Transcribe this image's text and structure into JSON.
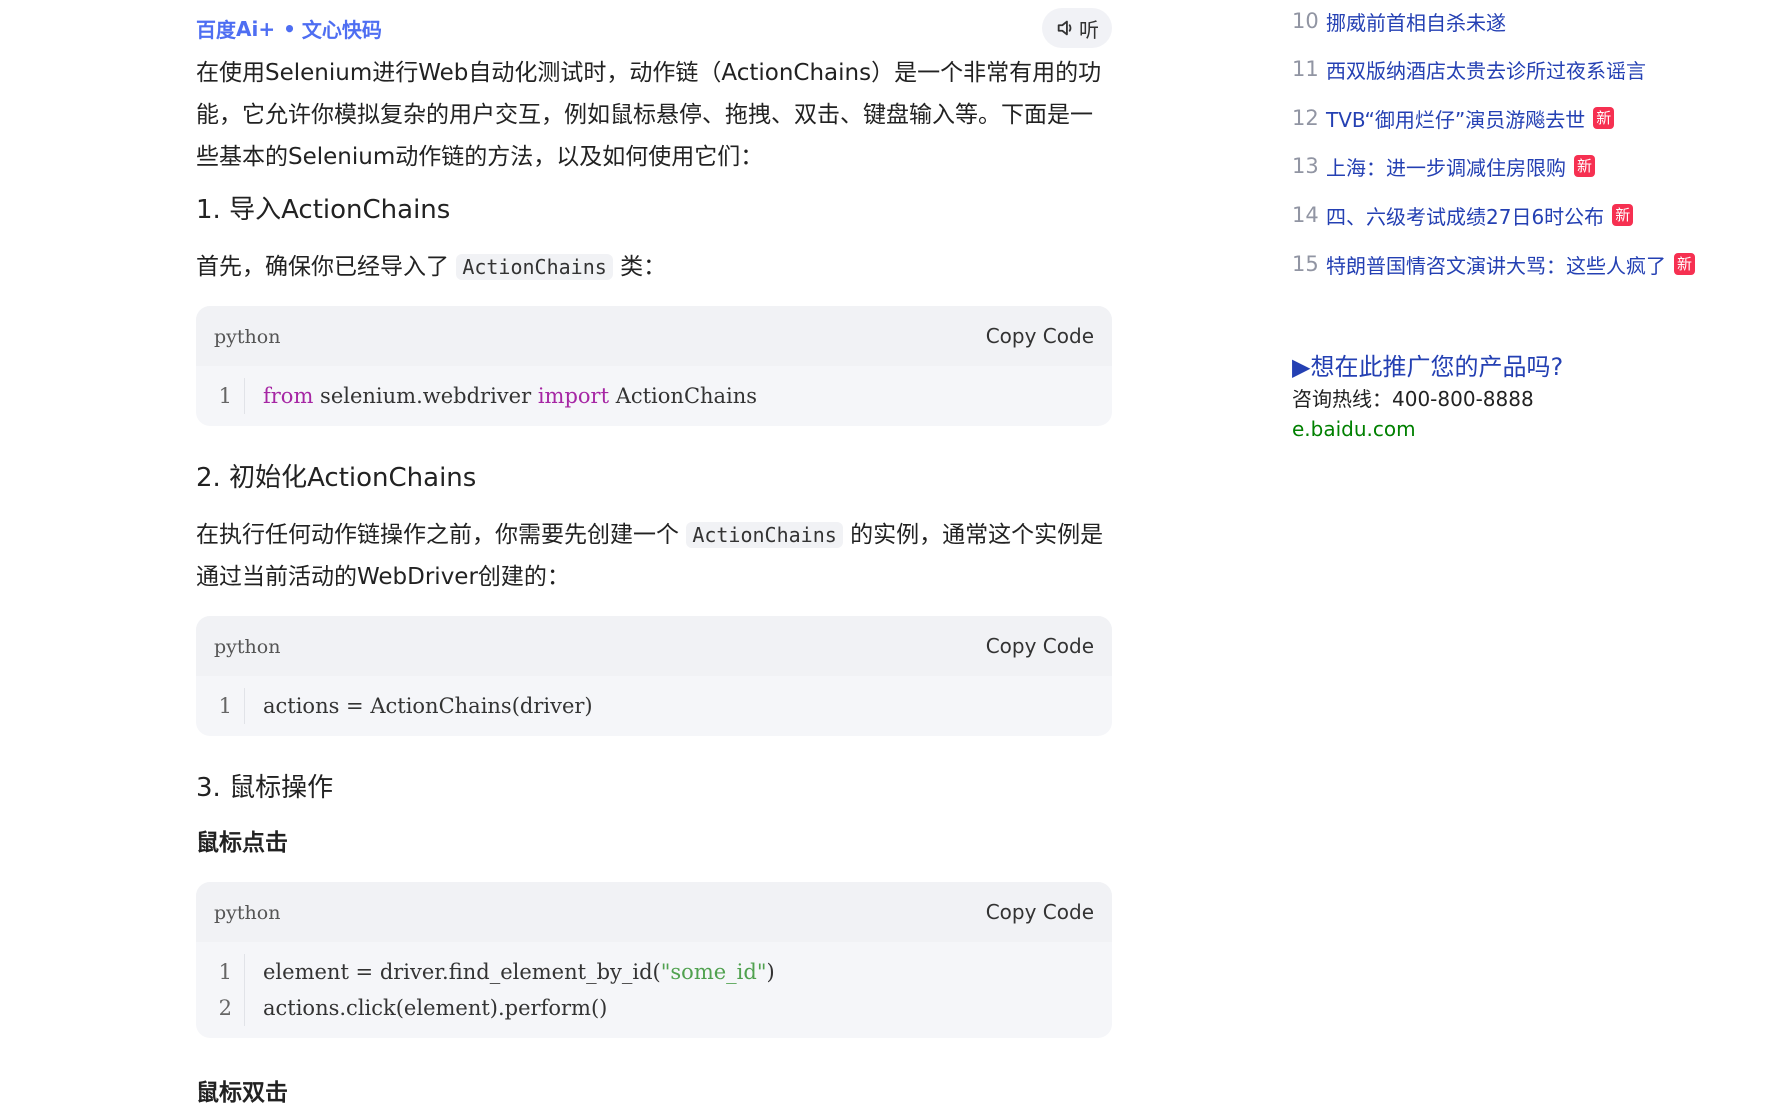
{
  "header": {
    "brand": "百度",
    "brand_ai": "Ai+",
    "brand_product": "文心快码",
    "listen_label": "听"
  },
  "article": {
    "intro": "在使用Selenium进行Web自动化测试时，动作链（ActionChains）是一个非常有用的功能，它允许你模拟复杂的用户交互，例如鼠标悬停、拖拽、双击、键盘输入等。下面是一些基本的Selenium动作链的方法，以及如何使用它们：",
    "sec1_title": "1. 导入ActionChains",
    "sec1_text_before": "首先，确保你已经导入了",
    "sec1_code_inline": "ActionChains",
    "sec1_text_after": "类：",
    "code1": {
      "lang": "python",
      "copy": "Copy Code",
      "line_no": "1",
      "kw_from": "from",
      "module": " selenium.webdriver ",
      "kw_import": "import",
      "name": " ActionChains"
    },
    "sec2_title": "2. 初始化ActionChains",
    "sec2_text_before": "在执行任何动作链操作之前，你需要先创建一个",
    "sec2_code_inline": "ActionChains",
    "sec2_text_after": "的实例，通常这个实例是通过当前活动的WebDriver创建的：",
    "code2": {
      "lang": "python",
      "copy": "Copy Code",
      "line_no": "1",
      "line": "actions = ActionChains(driver)"
    },
    "sec3_title": "3. 鼠标操作",
    "sub_click": "鼠标点击",
    "code3": {
      "lang": "python",
      "copy": "Copy Code",
      "line1_no": "1",
      "line1_pre": "element = driver.find_element_by_id(",
      "line1_str": "\"some_id\"",
      "line1_post": ")",
      "line2_no": "2",
      "line2": "actions.click(element).perform()"
    },
    "sub_double": "鼠标双击"
  },
  "hot_list": [
    {
      "rank": "10",
      "title": "挪威前首相自杀未遂",
      "new": ""
    },
    {
      "rank": "11",
      "title": "西双版纳酒店太贵去诊所过夜系谣言",
      "new": ""
    },
    {
      "rank": "12",
      "title": "TVB“御用烂仔”演员游飚去世",
      "new": "新"
    },
    {
      "rank": "13",
      "title": "上海：进一步调减住房限购",
      "new": "新"
    },
    {
      "rank": "14",
      "title": "四、六级考试成绩27日6时公布",
      "new": "新"
    },
    {
      "rank": "15",
      "title": "特朗普国情咨文演讲大骂：这些人疯了",
      "new": "新"
    }
  ],
  "ad": {
    "link": "▶想在此推广您的产品吗?",
    "phone": "咨询热线：400-800-8888",
    "site": "e.baidu.com"
  },
  "colors": {
    "brand_blue": "#4e6ef2",
    "link_blue": "#2440b3",
    "badge_red": "#f63051",
    "keyword_purple": "#a626a4",
    "string_green": "#50a14f",
    "ad_green": "#008000"
  }
}
